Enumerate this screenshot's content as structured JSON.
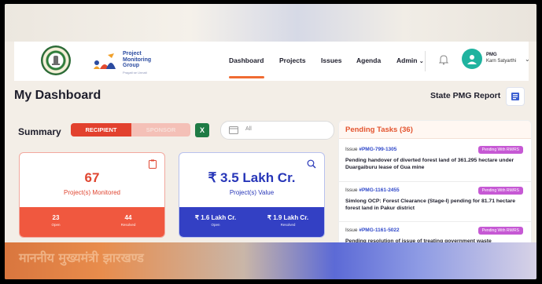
{
  "header": {
    "brand_line1": "Project",
    "brand_line2": "Monitoring",
    "brand_line3": "Group",
    "brand_tagline": "Pragati se Unnati",
    "nav": [
      "Dashboard",
      "Projects",
      "Issues",
      "Agenda",
      "Admin"
    ],
    "active_nav": "Dashboard",
    "user_role": "PMG",
    "user_name": "Karn Satyarthi"
  },
  "page": {
    "title": "My Dashboard",
    "state_report": "State PMG Report"
  },
  "summary": {
    "label": "Summary",
    "toggle_active": "RECIPIENT",
    "toggle_inactive": "SPONSOR",
    "excel_label": "X",
    "filter_value": "All"
  },
  "cards": {
    "monitored": {
      "value": "67",
      "label": "Project(s) Monitored",
      "open_value": "23",
      "open_label": "Open",
      "resolved_value": "44",
      "resolved_label": "Resolved"
    },
    "value": {
      "value": "₹ 3.5 Lakh Cr.",
      "label": "Project(s) Value",
      "open_value": "₹ 1.6 Lakh Cr.",
      "open_label": "Open",
      "resolved_value": "₹ 1.9 Lakh Cr.",
      "resolved_label": "Resolved"
    }
  },
  "tasks": {
    "title": "Pending Tasks (36)",
    "items": [
      {
        "issue_prefix": "Issue ",
        "issue_id": "#PMG-799-1305",
        "status": "Pending With RM/RS",
        "desc": "Pending handover of diverted forest land of 361.295 hectare under Duargaiburu lease of Gua mine"
      },
      {
        "issue_prefix": "Issue ",
        "issue_id": "#PMG-1161-2455",
        "status": "Pending With RM/RS",
        "desc": "Simlong OCP: Forest Clearance (Stage-I) pending for 81.71 hectare forest land in Pakur district"
      },
      {
        "issue_prefix": "Issue ",
        "issue_id": "#PMG-1161-5022",
        "status": "Pending With RM/RS",
        "desc": "Pending resolution of issue of treating government waste"
      }
    ]
  },
  "footer": {
    "text": "माननीय मुख्यमंत्री झारखण्ड"
  },
  "colors": {
    "accent_red": "#e2412e",
    "accent_blue": "#3340c4",
    "badge_purple": "#c659d4",
    "tasks_orange": "#e3542f"
  }
}
